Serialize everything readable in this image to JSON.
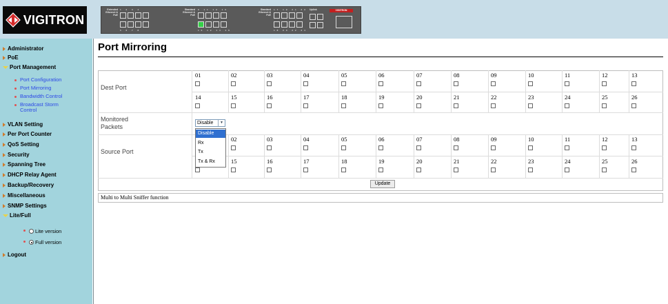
{
  "header": {
    "brand": "VIGITRON",
    "panel": {
      "label1": "Extended Ethernet & PoE",
      "label2": "Standard Ethernet & PoE",
      "label3": "Standard Ethernet & PoE",
      "label4": "Uplink",
      "badge": "VIGITRON",
      "numbers_top": [
        "1",
        "2",
        "3",
        "4",
        "9",
        "11",
        "13",
        "15",
        "17",
        "19",
        "21",
        "23",
        "25"
      ],
      "numbers_bottom": [
        "2",
        "4",
        "6",
        "8",
        "10",
        "12",
        "14",
        "16",
        "18",
        "20",
        "22",
        "24",
        "26"
      ],
      "active_port": "10"
    }
  },
  "sidebar": {
    "items": [
      {
        "label": "Administrator",
        "expanded": false
      },
      {
        "label": "PoE",
        "expanded": false
      },
      {
        "label": "Port Management",
        "expanded": true
      },
      {
        "label": "VLAN Setting",
        "expanded": false
      },
      {
        "label": "Per Port Counter",
        "expanded": false
      },
      {
        "label": "QoS Setting",
        "expanded": false
      },
      {
        "label": "Security",
        "expanded": false
      },
      {
        "label": "Spanning Tree",
        "expanded": false
      },
      {
        "label": "DHCP Relay Agent",
        "expanded": false
      },
      {
        "label": "Backup/Recovery",
        "expanded": false
      },
      {
        "label": "Miscellaneous",
        "expanded": false
      },
      {
        "label": "SNMP Settings",
        "expanded": false
      },
      {
        "label": "Lite/Full",
        "expanded": true
      },
      {
        "label": "Logout",
        "expanded": false
      }
    ],
    "port_management_sub": [
      "Port Configuration",
      "Port Mirroring",
      "Bandwidth Control",
      "Broadcast Storm Control"
    ],
    "lite_full": {
      "options": [
        "Lite version",
        "Full version"
      ],
      "selected": "Full version"
    }
  },
  "main": {
    "title": "Port Mirroring",
    "dest_port_label": "Dest Port",
    "monitored_label": "Monitored Packets",
    "source_port_label": "Source Port",
    "ports_row1": [
      "01",
      "02",
      "03",
      "04",
      "05",
      "06",
      "07",
      "08",
      "09",
      "10",
      "11",
      "12",
      "13"
    ],
    "ports_row2": [
      "14",
      "15",
      "16",
      "17",
      "18",
      "19",
      "20",
      "21",
      "22",
      "23",
      "24",
      "25",
      "26"
    ],
    "monitored": {
      "selected": "Disable",
      "options": [
        "Disable",
        "Rx",
        "Tx",
        "Tx & Rx"
      ],
      "highlighted": "Disable"
    },
    "update_button": "Update",
    "note": "Multi to Multi Sniffer function"
  },
  "colors": {
    "header_bg": "#c8dde8",
    "sidebar_bg": "#a2d4dd",
    "submenu_link": "#2c48e6",
    "dropdown_highlight": "#3070d0"
  }
}
